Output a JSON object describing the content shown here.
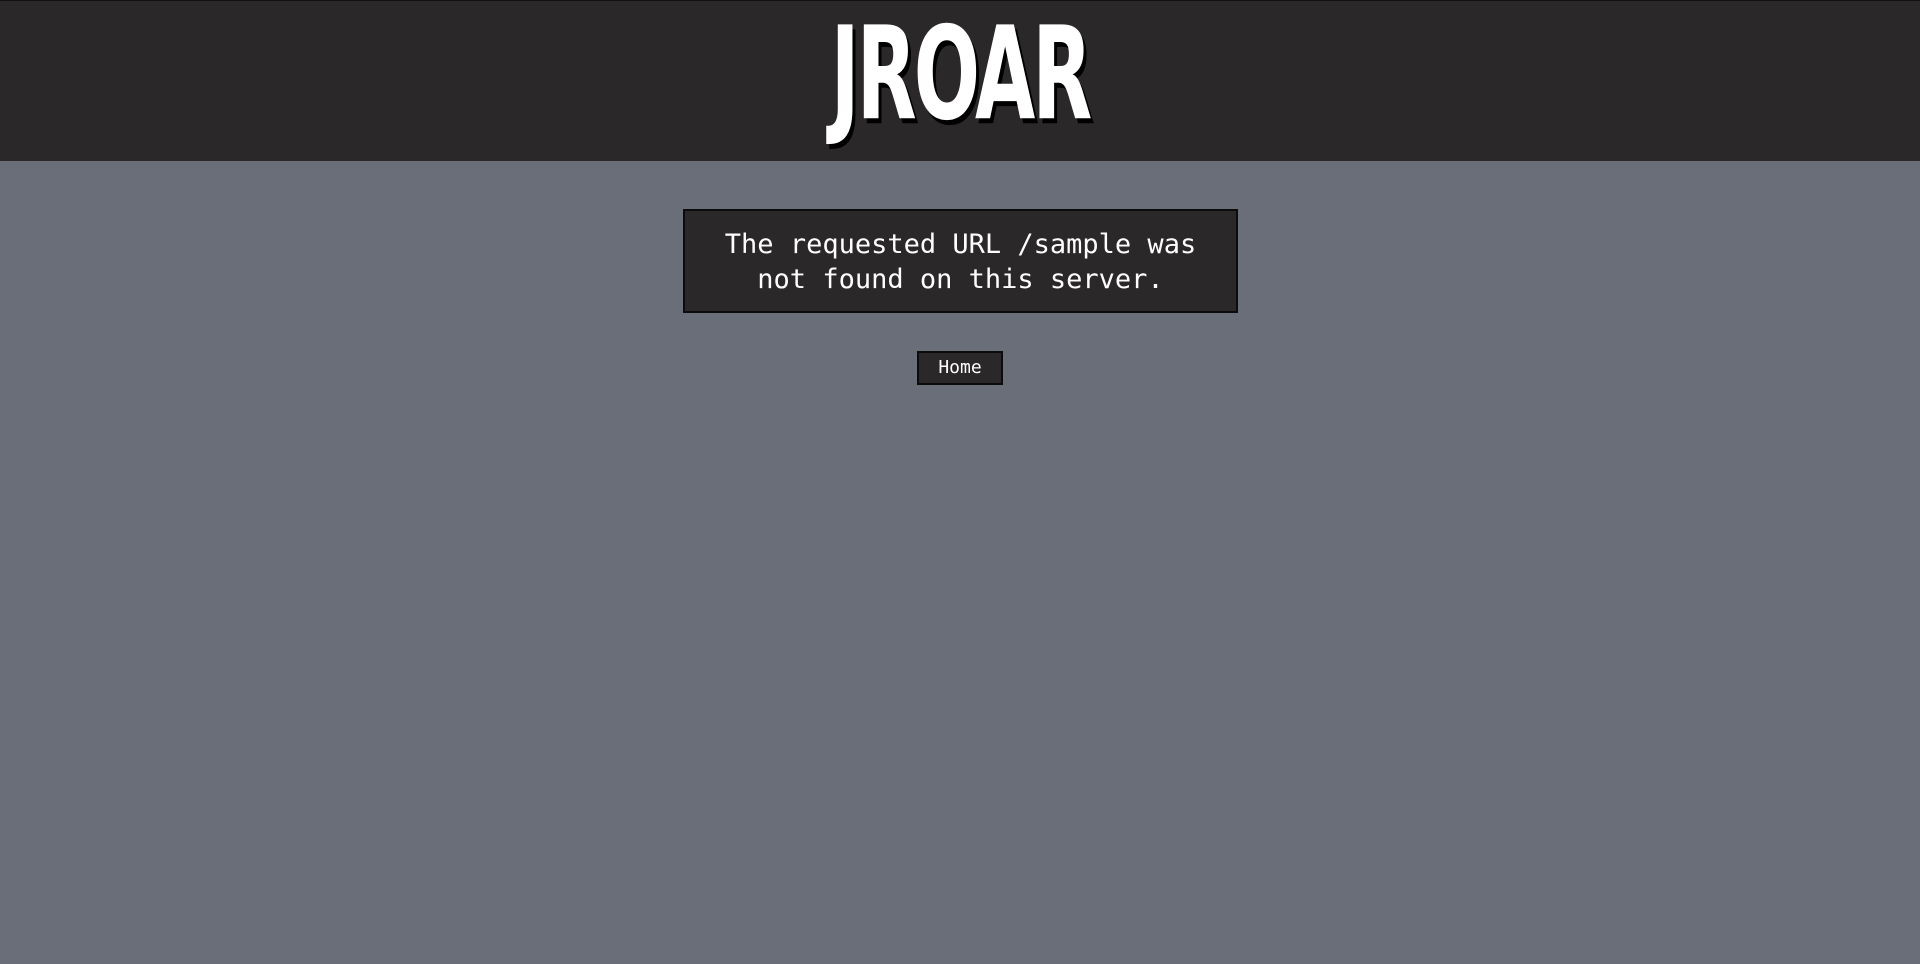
{
  "header": {
    "logo_text": "JROAR"
  },
  "error": {
    "message": "The requested URL /sample was not found on this server."
  },
  "nav": {
    "home_label": "Home"
  },
  "colors": {
    "page_background": "#6a6e78",
    "header_background": "#2a2829",
    "box_background": "#2a2829",
    "text": "#ffffff"
  }
}
